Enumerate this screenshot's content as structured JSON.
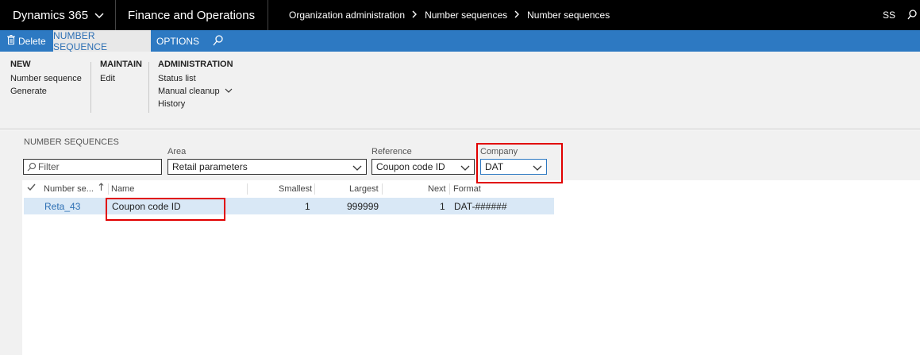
{
  "topbar": {
    "product": "Dynamics 365",
    "app": "Finance and Operations",
    "breadcrumb": [
      "Organization administration",
      "Number sequences",
      "Number sequences"
    ],
    "user_initials": "SS"
  },
  "actionpane": {
    "delete_label": "Delete",
    "tabs": [
      "NUMBER SEQUENCE",
      "OPTIONS"
    ]
  },
  "ribbon": {
    "new": {
      "title": "NEW",
      "items": [
        "Number sequence",
        "Generate"
      ]
    },
    "maintain": {
      "title": "MAINTAIN",
      "items": [
        "Edit"
      ]
    },
    "administration": {
      "title": "ADMINISTRATION",
      "items": [
        "Status list",
        "Manual cleanup",
        "History"
      ]
    }
  },
  "filters": {
    "pane_title": "NUMBER SEQUENCES",
    "filter_placeholder": "Filter",
    "area_label": "Area",
    "area_value": "Retail parameters",
    "reference_label": "Reference",
    "reference_value": "Coupon code ID",
    "company_label": "Company",
    "company_value": "DAT"
  },
  "grid": {
    "columns": [
      "Number se...",
      "Name",
      "Smallest",
      "Largest",
      "Next",
      "Format"
    ],
    "rows": [
      {
        "number_sequence": "Reta_43",
        "name": "Coupon code ID",
        "smallest": "1",
        "largest": "999999",
        "next": "1",
        "format": "DAT-######"
      }
    ]
  },
  "colors": {
    "topbar": "#000000",
    "action_pane": "#2d79c2",
    "highlight": "#e10000",
    "selected_row": "#d9e8f6"
  }
}
